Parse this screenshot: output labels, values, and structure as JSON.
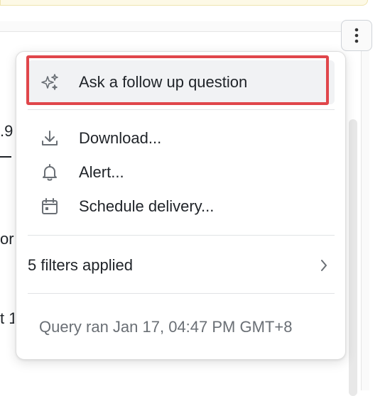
{
  "menu": {
    "ask_follow_up": "Ask a follow up question",
    "download": "Download...",
    "alert": "Alert...",
    "schedule_delivery": "Schedule delivery...",
    "filters_applied": "5 filters applied",
    "query_ran": "Query ran Jan 17, 04:47 PM GMT+8"
  },
  "background": {
    "fragment_1": ".9",
    "fragment_3": "or",
    "fragment_4": "t 1"
  },
  "icons": {
    "ask_follow_up": "sparkle-icon",
    "download": "download-icon",
    "alert": "bell-icon",
    "schedule_delivery": "calendar-icon",
    "filters_applied": "chevron-right-icon",
    "more_options": "kebab-vertical-icon"
  },
  "colors": {
    "highlight_border": "#e0464b",
    "active_item_bg": "#f1f2f4",
    "muted_text": "#6a6f75",
    "icon_gray": "#6a6f75"
  }
}
